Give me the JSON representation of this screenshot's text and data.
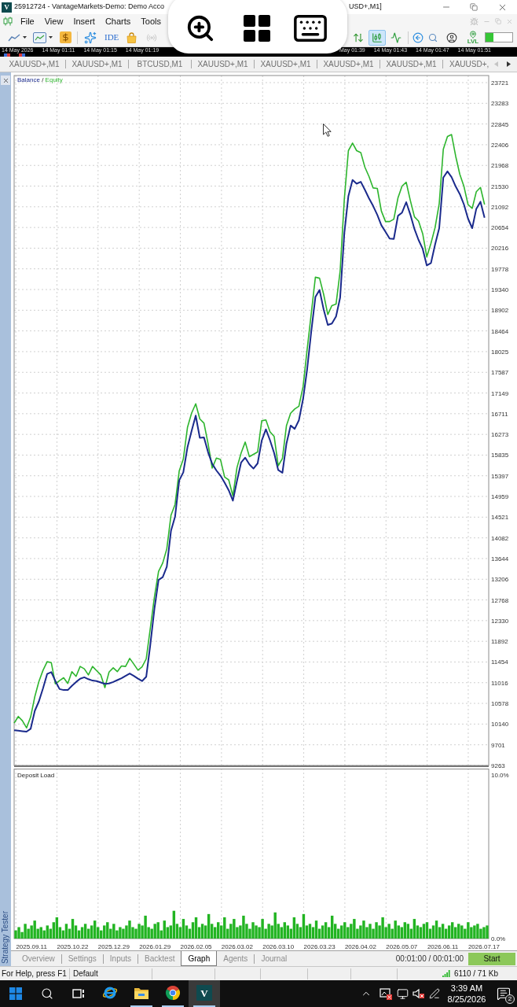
{
  "window": {
    "logo_text": "V",
    "title_start": "25912724 - VantageMarkets-Demo: Demo Acco",
    "title_end": "USD+,M1]"
  },
  "menu": [
    "File",
    "View",
    "Insert",
    "Charts",
    "Tools"
  ],
  "toolbar": {
    "ide_label": "IDE",
    "chart_types": [
      {
        "kind": "bars",
        "selected": false
      },
      {
        "kind": "candles",
        "selected": true
      },
      {
        "kind": "line",
        "selected": false
      }
    ],
    "badge_label": "LVL",
    "meter": {
      "level": 0.28
    }
  },
  "time_strip": {
    "left": [
      "14 May 2026",
      "14 May 01:11",
      "14 May 01:15",
      "14 May 01:19"
    ],
    "right": [
      "May 01:39",
      "14 May 01:43",
      "14 May 01:47",
      "14 May 01:51"
    ]
  },
  "chart_tabs": [
    "XAUUSD+,M1",
    "XAUUSD+,M1",
    "BTCUSD,M1",
    "XAUUSD+,M1",
    "XAUUSD+,M1",
    "XAUUSD+,M1",
    "XAUUSD+,M1",
    "XAUUSD+,"
  ],
  "tester": {
    "side_label": "Strategy Tester",
    "balance_chart": {
      "legend_separator": "/",
      "chart_data": {
        "type": "line",
        "grid": true,
        "ylim": [
          9263,
          23871
        ],
        "yticks": [
          9263,
          9701,
          10140,
          10578,
          11016,
          11454,
          11892,
          12330,
          12768,
          13206,
          13644,
          14082,
          14521,
          14959,
          15397,
          15835,
          16273,
          16711,
          17149,
          17587,
          18025,
          18464,
          18902,
          19340,
          19778,
          20216,
          20654,
          21092,
          21530,
          21968,
          22406,
          22845,
          23283,
          23721
        ],
        "categories": [
          null,
          null,
          null,
          null,
          null,
          null,
          null,
          null,
          null,
          null,
          null,
          null,
          null,
          null,
          null,
          null,
          null,
          null,
          null,
          null,
          null,
          null,
          null,
          null,
          null,
          null,
          null,
          null,
          null,
          null,
          null,
          null,
          null,
          null,
          null,
          null,
          null,
          null,
          null,
          null,
          null,
          null,
          null,
          null,
          null,
          null,
          null,
          null,
          null,
          null,
          null,
          null,
          null,
          null,
          null,
          null,
          null,
          null,
          null,
          null,
          null,
          null,
          null,
          null,
          null,
          null,
          null,
          null,
          null,
          null,
          null,
          null,
          null,
          null,
          null,
          null,
          null,
          null,
          null,
          null,
          null,
          null,
          null,
          null,
          null,
          null,
          null,
          null,
          null,
          null,
          null,
          null,
          null,
          null,
          null,
          null,
          null,
          null,
          null,
          null,
          null,
          null,
          null,
          null,
          null,
          null,
          null,
          null,
          null,
          null,
          null,
          null,
          null,
          null,
          null,
          null
        ],
        "series": [
          {
            "name": "Balance",
            "color": "#1a2a8c",
            "values": [
              10010,
              10000,
              9990,
              9980,
              10040,
              10420,
              10620,
              10900,
              11200,
              11240,
              11050,
              10880,
              10860,
              10860,
              10950,
              11030,
              11100,
              11130,
              11090,
              11060,
              11050,
              11020,
              10990,
              11000,
              11030,
              11070,
              11110,
              11160,
              11210,
              11160,
              11100,
              11050,
              11140,
              11820,
              12590,
              13190,
              13250,
              13470,
              14230,
              14530,
              15300,
              15470,
              16000,
              16340,
              16670,
              16200,
              16210,
              15890,
              15650,
              15510,
              15400,
              15250,
              15090,
              14870,
              15290,
              15680,
              15780,
              15640,
              15550,
              15660,
              16140,
              16380,
              16150,
              15880,
              15520,
              15460,
              16080,
              16460,
              16390,
              16570,
              17020,
              17650,
              18460,
              19180,
              19330,
              18920,
              18590,
              18620,
              18770,
              19170,
              20530,
              21320,
              21660,
              21580,
              21620,
              21450,
              21270,
              21110,
              20920,
              20700,
              20560,
              20420,
              20410,
              20900,
              20970,
              21190,
              20930,
              20620,
              20390,
              20200,
              19850,
              19900,
              20290,
              20640,
              21710,
              21840,
              21720,
              21520,
              21360,
              21140,
              20840,
              20640,
              21050,
              21200,
              20860,
              null
            ]
          },
          {
            "name": "Equity",
            "color": "#2db52d",
            "values": [
              10160,
              10300,
              10210,
              10060,
              10290,
              10720,
              11040,
              11280,
              11460,
              11440,
              10990,
              11060,
              11120,
              11000,
              11250,
              11150,
              11360,
              11310,
              11180,
              11360,
              11270,
              11180,
              10910,
              11240,
              11330,
              11250,
              11370,
              11360,
              11530,
              11410,
              11280,
              11350,
              11520,
              12170,
              12840,
              13370,
              13550,
              13850,
              14560,
              14790,
              15500,
              15750,
              16420,
              16720,
              16920,
              16600,
              16510,
              16070,
              15560,
              15770,
              15740,
              15370,
              15310,
              14970,
              15570,
              15880,
              16110,
              15800,
              15850,
              15900,
              16560,
              16580,
              16330,
              16230,
              15610,
              15760,
              16460,
              16720,
              16810,
              16870,
              17280,
              18070,
              18840,
              19600,
              19580,
              19240,
              18810,
              19000,
              19030,
              19730,
              21250,
              22280,
              22440,
              22280,
              22240,
              21930,
              21730,
              21490,
              21480,
              21000,
              20780,
              20780,
              20830,
              21280,
              21530,
              21610,
              21230,
              20880,
              20790,
              20520,
              20030,
              20320,
              20650,
              21160,
              22310,
              22580,
              22620,
              22160,
              21780,
              21520,
              21140,
              21060,
              21410,
              21500,
              21140,
              null
            ]
          }
        ]
      }
    },
    "deposit_chart": {
      "chart_data": {
        "type": "bar",
        "title": "Deposit Load",
        "grid": true,
        "ylim": [
          0,
          10.4
        ],
        "yticks": [
          {
            "value": 0,
            "label": "0.0%"
          },
          {
            "value": 10,
            "label": "10.0%"
          }
        ],
        "categories": [
          null,
          null,
          null,
          null,
          null,
          "2025.09.11",
          null,
          null,
          null,
          null,
          null,
          null,
          null,
          null,
          null,
          null,
          null,
          null,
          "2025.10.22",
          null,
          null,
          null,
          null,
          null,
          null,
          null,
          null,
          null,
          null,
          null,
          null,
          "2025.12.29",
          null,
          null,
          null,
          null,
          null,
          null,
          null,
          null,
          null,
          null,
          null,
          null,
          "2026.01.29",
          null,
          null,
          null,
          null,
          null,
          null,
          null,
          null,
          null,
          null,
          null,
          null,
          "2026.02.05",
          null,
          null,
          null,
          null,
          null,
          null,
          null,
          null,
          null,
          null,
          null,
          null,
          "2026.03.02",
          null,
          null,
          null,
          null,
          null,
          null,
          null,
          null,
          null,
          null,
          null,
          null,
          "2026.03.10",
          null,
          null,
          null,
          null,
          null,
          null,
          null,
          null,
          null,
          null,
          null,
          null,
          "2026.03.23",
          null,
          null,
          null,
          null,
          null,
          null,
          null,
          null,
          null,
          null,
          null,
          null,
          "2026.04.02",
          null,
          null,
          null,
          null,
          null,
          null,
          null,
          null,
          null,
          null,
          null,
          null,
          "2026.05.07",
          null,
          null,
          null,
          null,
          null,
          null,
          null,
          null,
          null,
          null,
          null,
          null,
          "2026.06.11",
          null,
          null,
          null,
          null,
          null,
          null,
          null,
          null,
          null,
          null,
          null,
          null,
          "2026.07.17",
          null
        ],
        "series": [
          {
            "color": "#22b422",
            "values": [
              0.5,
              0.7,
              0.4,
              0.9,
              0.6,
              0.8,
              1.1,
              0.6,
              0.7,
              0.5,
              0.8,
              0.6,
              1.0,
              1.3,
              0.7,
              0.5,
              0.9,
              0.6,
              1.2,
              0.8,
              0.5,
              0.7,
              0.9,
              0.6,
              0.8,
              1.1,
              0.7,
              0.5,
              0.8,
              1.0,
              0.6,
              0.9,
              0.5,
              0.7,
              0.6,
              0.8,
              1.1,
              0.7,
              0.6,
              0.9,
              0.8,
              1.4,
              0.7,
              0.6,
              0.9,
              1.0,
              0.5,
              1.1,
              0.7,
              0.8,
              1.7,
              0.9,
              0.7,
              1.2,
              0.8,
              0.6,
              1.0,
              1.3,
              0.7,
              0.9,
              0.8,
              1.5,
              0.9,
              0.7,
              1.0,
              0.8,
              1.3,
              0.6,
              0.9,
              1.2,
              0.7,
              0.8,
              1.4,
              0.9,
              0.6,
              1.0,
              0.8,
              0.7,
              1.2,
              0.6,
              0.9,
              0.8,
              1.6,
              0.9,
              0.7,
              1.0,
              0.8,
              0.6,
              1.3,
              0.9,
              0.7,
              1.5,
              0.8,
              0.9,
              0.7,
              1.1,
              0.6,
              0.8,
              1.0,
              0.7,
              1.4,
              0.9,
              0.6,
              0.8,
              1.0,
              0.7,
              0.9,
              1.2,
              0.6,
              0.8,
              1.1,
              0.7,
              0.9,
              0.6,
              1.0,
              0.8,
              1.3,
              0.7,
              0.9,
              0.6,
              1.1,
              0.8,
              0.7,
              1.0,
              0.9,
              0.6,
              1.2,
              0.8,
              0.7,
              0.9,
              1.0,
              0.6,
              0.8,
              1.1,
              0.7,
              0.9,
              0.6,
              0.8,
              1.0,
              0.7,
              0.9,
              0.8,
              0.6,
              1.0,
              0.7,
              0.8,
              0.9,
              0.6,
              0.7,
              0.8
            ]
          }
        ]
      }
    },
    "tabs": [
      {
        "label": "Overview",
        "selected": false
      },
      {
        "label": "Settings",
        "selected": false
      },
      {
        "label": "Inputs",
        "selected": false
      },
      {
        "label": "Backtest",
        "selected": false
      },
      {
        "label": "Graph",
        "selected": true
      },
      {
        "label": "Agents",
        "selected": false
      },
      {
        "label": "Journal",
        "selected": false
      }
    ],
    "elapsed": "00:01:00 / 00:01:00",
    "start_button": "Start"
  },
  "status_bar": {
    "help": "For Help, press F1",
    "profile": "Default",
    "traffic": "6110 / 71 Kb"
  },
  "taskbar": {
    "apps": [
      {
        "kind": "browser",
        "running": false,
        "active": false
      },
      {
        "kind": "folder",
        "running": true,
        "active": false
      },
      {
        "kind": "chrome",
        "running": true,
        "active": false
      },
      {
        "kind": "app",
        "logo_text": "V",
        "running": true,
        "active": true
      }
    ],
    "time": "3:39 AM",
    "date": "8/25/2026",
    "notification_count": "2"
  }
}
